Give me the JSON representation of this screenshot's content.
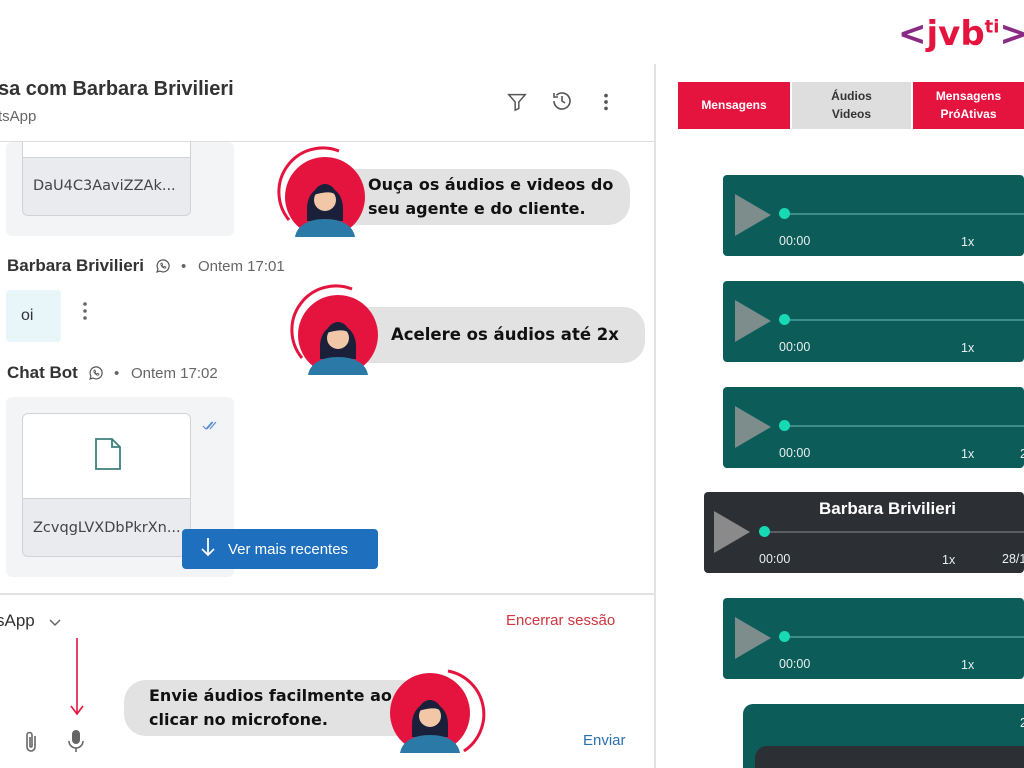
{
  "brand": {
    "logo_left": "<",
    "logo_main": "jvb",
    "logo_sup": "ti",
    "logo_right": ">",
    "accent": "#e5143f",
    "purple": "#8a2b83"
  },
  "header": {
    "title": "sa com Barbara Brivilieri",
    "subtitle": "tsApp",
    "icons": [
      "filter-icon",
      "history-icon",
      "more-vertical-icon"
    ]
  },
  "chat": {
    "file1_name": "DaU4C3AaviZZAk...",
    "msg1": {
      "sender": "Barbara Brivilieri",
      "dot": "•",
      "time": "Ontem 17:01",
      "text": "oi"
    },
    "msg2": {
      "sender": "Chat Bot",
      "dot": "•",
      "time": "Ontem 17:02",
      "file_name": "ZcvqgLVXDbPkrXn..."
    },
    "ver_mais": "Ver mais recentes"
  },
  "footer": {
    "channel": "sApp",
    "encerrar": "Encerrar sessão",
    "enviar": "Enviar"
  },
  "callouts": {
    "c1": "Ouça os áudios e videos do seu agente e do cliente.",
    "c2": "Acelere os áudios até 2x",
    "c3": "Envie áudios facilmente ao clicar no microfone."
  },
  "tabs": [
    {
      "label": "Mensagens"
    },
    {
      "label": "Áudios Videos"
    },
    {
      "label": "Mensagens PróAtivas"
    }
  ],
  "players": [
    {
      "time": "00:00",
      "speed": "1x",
      "date": ""
    },
    {
      "time": "00:00",
      "speed": "1x",
      "date": ""
    },
    {
      "time": "00:00",
      "speed": "1x",
      "date": "2"
    },
    {
      "name": "Barbara Brivilieri",
      "time": "00:00",
      "speed": "1x",
      "date": "28/1"
    },
    {
      "time": "00:00",
      "speed": "1x",
      "date": ""
    }
  ],
  "player_partial_label": "2"
}
